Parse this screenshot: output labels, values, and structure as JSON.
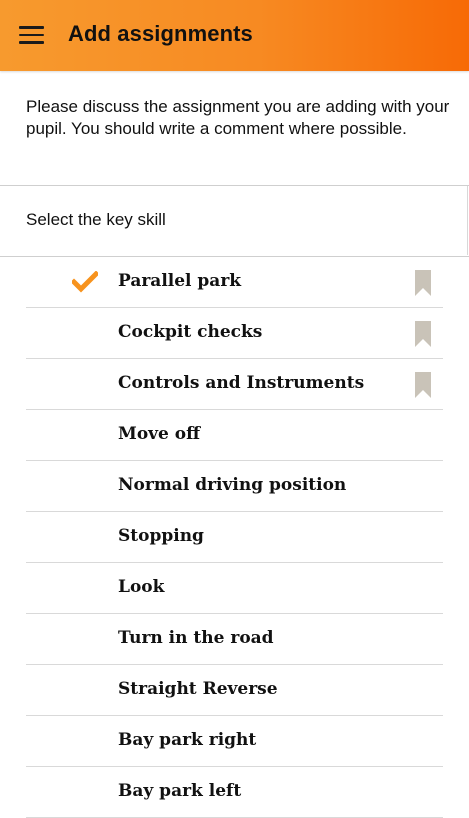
{
  "header": {
    "title": "Add assignments",
    "menu_icon": "hamburger-menu-icon",
    "gradient_colors": [
      "#f79a2e",
      "#f76a06"
    ]
  },
  "info_text": "Please discuss the assignment you are adding with your pupil.  You should write a comment where possible.",
  "select": {
    "label": "Select the key skill"
  },
  "accent_color": "#f7931e",
  "bookmark_color": "#c9c3b8",
  "skills": [
    {
      "label": "Parallel park",
      "selected": true,
      "bookmarked": true
    },
    {
      "label": "Cockpit checks",
      "selected": false,
      "bookmarked": true
    },
    {
      "label": "Controls and Instruments",
      "selected": false,
      "bookmarked": true
    },
    {
      "label": "Move off",
      "selected": false,
      "bookmarked": false
    },
    {
      "label": "Normal driving position",
      "selected": false,
      "bookmarked": false
    },
    {
      "label": "Stopping",
      "selected": false,
      "bookmarked": false
    },
    {
      "label": "Look",
      "selected": false,
      "bookmarked": false
    },
    {
      "label": "Turn in the road",
      "selected": false,
      "bookmarked": false
    },
    {
      "label": "Straight Reverse",
      "selected": false,
      "bookmarked": false
    },
    {
      "label": "Bay park right",
      "selected": false,
      "bookmarked": false
    },
    {
      "label": "Bay park left",
      "selected": false,
      "bookmarked": false
    }
  ]
}
